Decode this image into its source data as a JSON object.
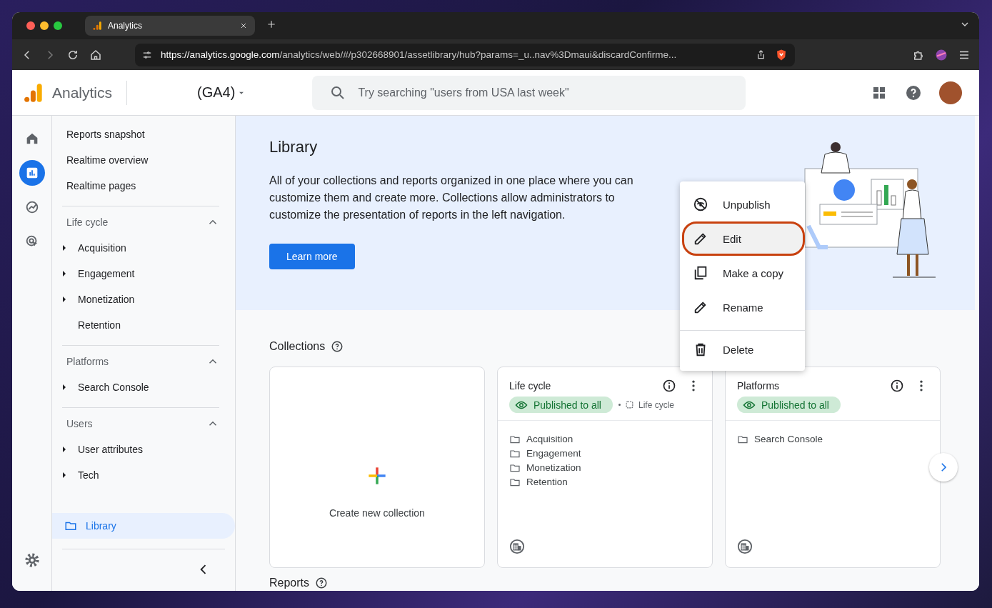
{
  "browser": {
    "tab_title": "Analytics",
    "url_host": "https://analytics.google.com",
    "url_path": "/analytics/web/#/p302668901/assetlibrary/hub?params=_u..nav%3Dmaui&discardConfirme..."
  },
  "header": {
    "app_name": "Analytics",
    "property": "(GA4)",
    "search_placeholder": "Try searching \"users from USA last week\""
  },
  "rail": [
    {
      "kind": "home",
      "selected": false
    },
    {
      "kind": "reports",
      "selected": true
    },
    {
      "kind": "explore",
      "selected": false
    },
    {
      "kind": "advertising",
      "selected": false
    }
  ],
  "nav": {
    "top_items": [
      "Reports snapshot",
      "Realtime overview",
      "Realtime pages"
    ],
    "sections": [
      {
        "title": "Life cycle",
        "expanded": true,
        "items": [
          {
            "label": "Acquisition",
            "expandable": true
          },
          {
            "label": "Engagement",
            "expandable": true
          },
          {
            "label": "Monetization",
            "expandable": true
          },
          {
            "label": "Retention",
            "expandable": false
          }
        ]
      },
      {
        "title": "Platforms",
        "expanded": true,
        "items": [
          {
            "label": "Search Console",
            "expandable": true
          }
        ]
      },
      {
        "title": "Users",
        "expanded": true,
        "items": [
          {
            "label": "User attributes",
            "expandable": true
          },
          {
            "label": "Tech",
            "expandable": true
          }
        ]
      }
    ],
    "library": {
      "label": "Library",
      "selected": true
    }
  },
  "banner": {
    "title": "Library",
    "text": "All of your collections and reports organized in one place where you can customize them and create more. Collections allow administrators to customize the presentation of reports in the left navigation.",
    "button": "Learn more"
  },
  "menu": {
    "groups": [
      [
        {
          "label": "Unpublish",
          "highlighted": false
        },
        {
          "label": "Edit",
          "highlighted": true
        },
        {
          "label": "Make a copy",
          "highlighted": false
        },
        {
          "label": "Rename",
          "highlighted": false
        }
      ],
      [
        {
          "label": "Delete",
          "highlighted": false
        }
      ]
    ]
  },
  "collections": {
    "heading": "Collections",
    "create_label": "Create new collection",
    "cards": [
      {
        "title": "Life cycle",
        "status": "Published to all",
        "template": "Life cycle",
        "folders": [
          "Acquisition",
          "Engagement",
          "Monetization",
          "Retention"
        ]
      },
      {
        "title": "Platforms",
        "status": "Published to all",
        "folders": [
          "Search Console"
        ]
      }
    ]
  },
  "reports": {
    "heading": "Reports"
  }
}
